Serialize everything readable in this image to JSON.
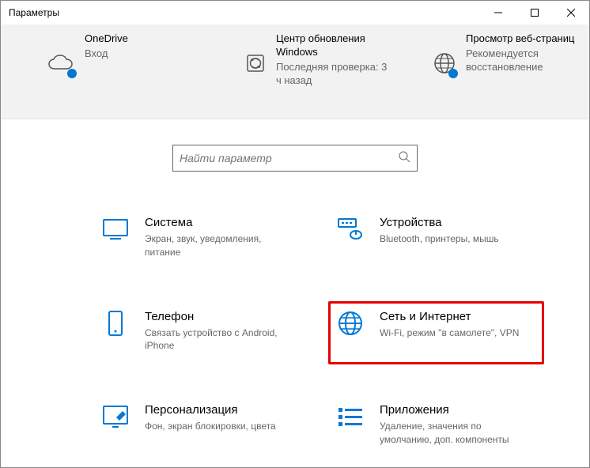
{
  "window": {
    "title": "Параметры"
  },
  "banner": [
    {
      "title": "OneDrive",
      "sub": "Вход"
    },
    {
      "title": "Центр обновления Windows",
      "sub": "Последняя проверка: 3 ч назад"
    },
    {
      "title": "Просмотр веб-страниц",
      "sub": "Рекомендуется восстановление"
    }
  ],
  "search": {
    "placeholder": "Найти параметр"
  },
  "categories": [
    {
      "title": "Система",
      "sub": "Экран, звук, уведомления, питание"
    },
    {
      "title": "Устройства",
      "sub": "Bluetooth, принтеры, мышь"
    },
    {
      "title": "Телефон",
      "sub": "Связать устройство с Android, iPhone"
    },
    {
      "title": "Сеть и Интернет",
      "sub": "Wi-Fi, режим \"в самолете\", VPN"
    },
    {
      "title": "Персонализация",
      "sub": "Фон, экран блокировки, цвета"
    },
    {
      "title": "Приложения",
      "sub": "Удаление, значения по умолчанию, доп. компоненты"
    }
  ]
}
